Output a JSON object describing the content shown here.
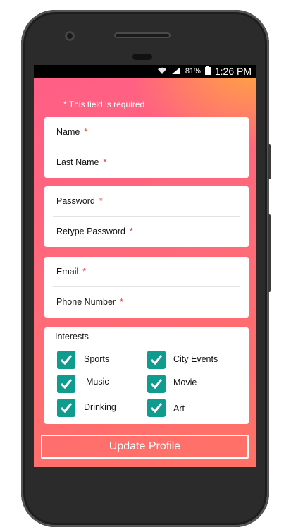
{
  "status_bar": {
    "battery": "81%",
    "time": "1:26 PM"
  },
  "form": {
    "required_note": "* This field is required",
    "required_mark": "*",
    "fields_group1": [
      {
        "label": "Name"
      },
      {
        "label": "Last Name"
      }
    ],
    "fields_group2": [
      {
        "label": "Password"
      },
      {
        "label": "Retype Password"
      }
    ],
    "fields_group3": [
      {
        "label": "Email"
      },
      {
        "label": "Phone Number"
      }
    ],
    "interests": {
      "title": "Interests",
      "options": [
        {
          "label": "Sports",
          "checked": true
        },
        {
          "label": "City Events",
          "checked": true
        },
        {
          "label": "Music",
          "checked": true
        },
        {
          "label": "Movie",
          "checked": true
        },
        {
          "label": "Drinking",
          "checked": true
        },
        {
          "label": "Art",
          "checked": true
        }
      ]
    },
    "submit_label": "Update Profile"
  },
  "colors": {
    "accent": "#0f9b8e",
    "gradient_start": "#ff5d86",
    "gradient_end": "#ff7166",
    "required": "#e53935"
  }
}
